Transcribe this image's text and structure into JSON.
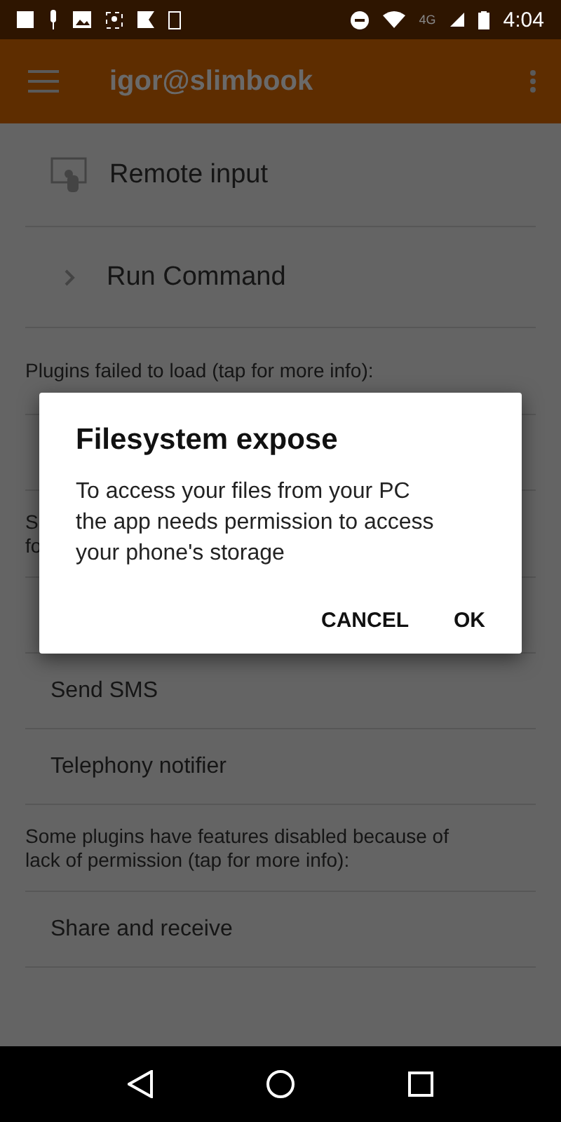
{
  "status_bar": {
    "time": "4:04",
    "network": "4G"
  },
  "app_bar": {
    "title": "igor@slimbook"
  },
  "rows": [
    {
      "kind": "icon_item",
      "text": "Remote input"
    },
    {
      "kind": "expand_item",
      "text": "Run Command"
    },
    {
      "kind": "header",
      "text": "Plugins failed to load (tap for more info):"
    },
    {
      "kind": "empty_item"
    },
    {
      "kind": "header",
      "text": "S\nfo"
    },
    {
      "kind": "empty_item"
    },
    {
      "kind": "item",
      "text": "Send SMS"
    },
    {
      "kind": "item",
      "text": "Telephony notifier"
    },
    {
      "kind": "header",
      "text": "Some plugins have features disabled because of\nlack of permission (tap for more info):"
    },
    {
      "kind": "item",
      "text": "Share and receive"
    }
  ],
  "dialog": {
    "title": "Filesystem expose",
    "message": "To access your files from your PC\nthe app needs permission to access\nyour phone's storage",
    "buttons": [
      "CANCEL",
      "OK"
    ]
  }
}
